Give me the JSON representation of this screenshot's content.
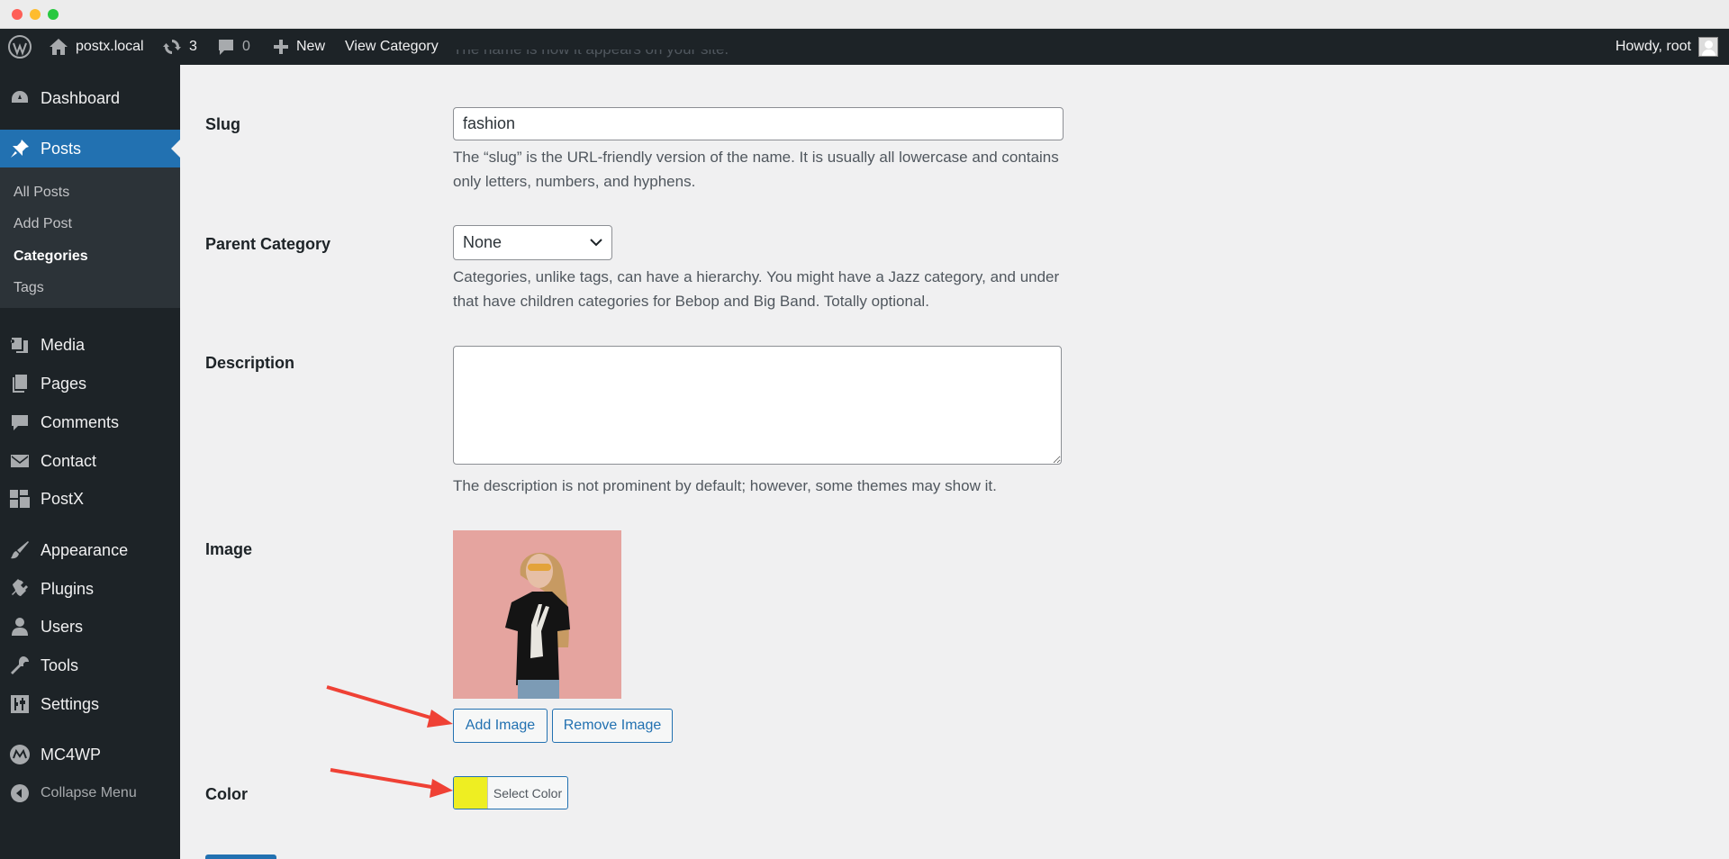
{
  "adminbar": {
    "site_name": "postx.local",
    "updates_count": "3",
    "comments_count": "0",
    "new_label": "New",
    "view_label": "View Category",
    "howdy": "Howdy, root"
  },
  "sidebar": {
    "dashboard": "Dashboard",
    "posts": "Posts",
    "submenu": [
      "All Posts",
      "Add Post",
      "Categories",
      "Tags"
    ],
    "media": "Media",
    "pages": "Pages",
    "comments": "Comments",
    "contact": "Contact",
    "postx": "PostX",
    "appearance": "Appearance",
    "plugins": "Plugins",
    "users": "Users",
    "tools": "Tools",
    "settings": "Settings",
    "mc4wp": "MC4WP",
    "collapse": "Collapse Menu"
  },
  "form": {
    "name_desc_partial": "The name is how it appears on your site.",
    "slug_label": "Slug",
    "slug_value": "fashion",
    "slug_desc": "The “slug” is the URL-friendly version of the name. It is usually all lowercase and contains only letters, numbers, and hyphens.",
    "parent_label": "Parent Category",
    "parent_value": "None",
    "parent_desc": "Categories, unlike tags, can have a hierarchy. You might have a Jazz category, and under that have children categories for Bebop and Big Band. Totally optional.",
    "description_label": "Description",
    "description_value": "",
    "description_desc": "The description is not prominent by default; however, some themes may show it.",
    "image_label": "Image",
    "add_image": "Add Image",
    "remove_image": "Remove Image",
    "color_label": "Color",
    "select_color": "Select Color",
    "color_value": "#eeee22"
  },
  "colors": {
    "accent": "#2271b1",
    "annotation_arrow": "#ef4135"
  }
}
